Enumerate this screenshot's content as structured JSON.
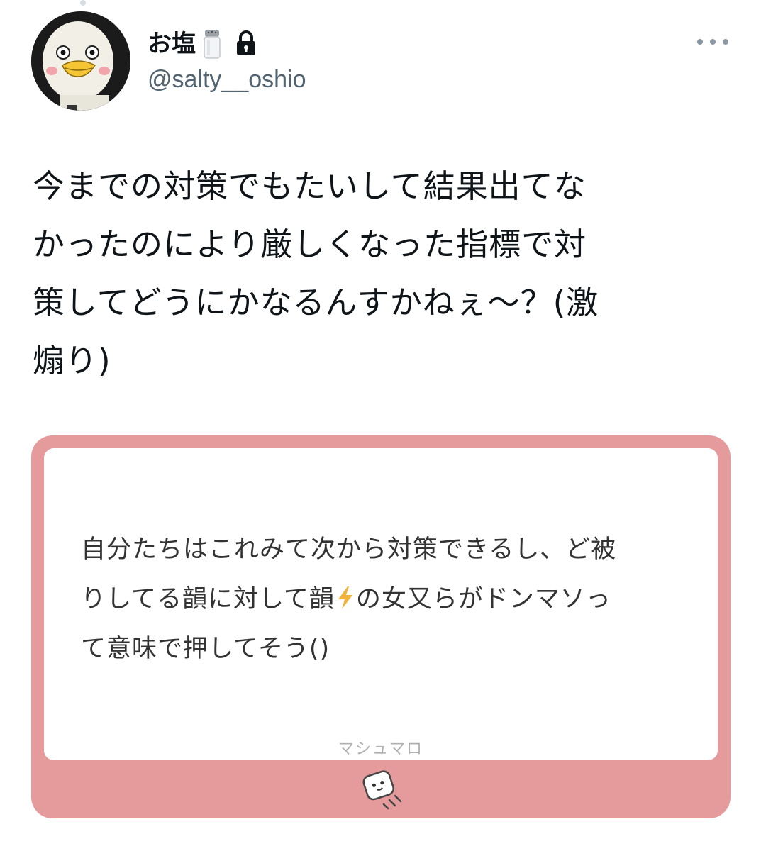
{
  "user": {
    "display_name": "お塩",
    "handle": "@salty__oshio"
  },
  "tweet": {
    "lines": [
      "今までの対策でもたいして結果出てな",
      "かったのにより厳しくなった指標で対",
      "策してどうにかなるんすかねぇ〜？(激",
      "煽り)"
    ]
  },
  "card": {
    "question_lines": [
      "自分たちはこれみて次から対策できるし、ど被",
      "りしてる韻に対して韻",
      "の女又らがドンマソっ",
      "て意味で押してそう()"
    ],
    "brand": "マシュマロ",
    "colors": {
      "frame": "#e59a9c",
      "inner": "#ffffff"
    }
  },
  "icons": [
    "salt-shaker-icon",
    "lock-icon",
    "more-icon",
    "marshmallow-logo-icon"
  ]
}
